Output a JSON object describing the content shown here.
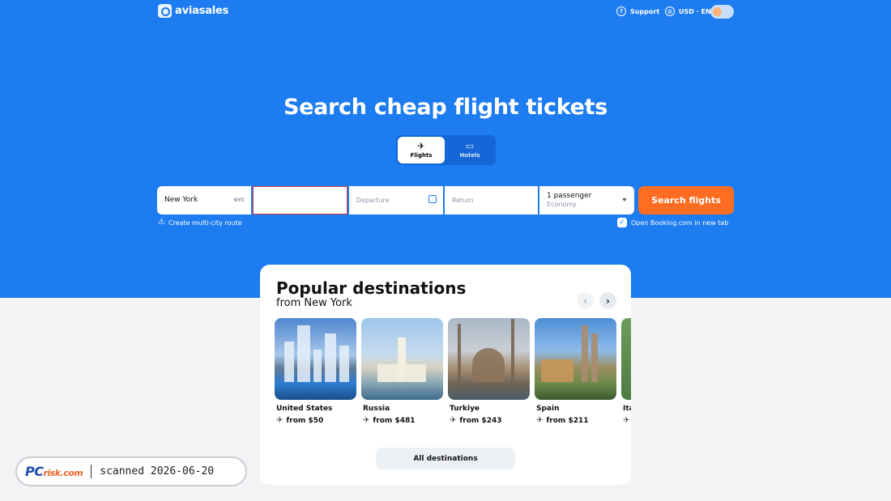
{
  "header": {
    "brand": "aviasales",
    "support_label": "Support",
    "locale_label": "USD · EN"
  },
  "hero": {
    "headline": "Search cheap flight tickets",
    "tabs": [
      {
        "label": "Flights",
        "icon": "plane-icon",
        "selected": true
      },
      {
        "label": "Hotels",
        "icon": "bed-icon",
        "selected": false
      }
    ]
  },
  "search": {
    "origin_value": "New York",
    "origin_code": "NYC",
    "destination_value": "",
    "departure_placeholder": "Departure",
    "return_placeholder": "Return",
    "passengers": "1 passenger",
    "cabin_class": "Economy",
    "submit_label": "Search flights",
    "multicity_label": "Create multi-city route",
    "booking_label": "Open Booking.com in new tab",
    "booking_checked": true
  },
  "popular": {
    "title": "Popular destinations",
    "subtitle": "from New York",
    "destinations": [
      {
        "name": "United States",
        "price": "from $50"
      },
      {
        "name": "Russia",
        "price": "from $481"
      },
      {
        "name": "Turkiye",
        "price": "from $243"
      },
      {
        "name": "Spain",
        "price": "from $211"
      },
      {
        "name": "Ita",
        "price": ""
      }
    ],
    "all_label": "All destinations"
  },
  "watermark": {
    "logo_main": "PC",
    "logo_rest": "risk.com",
    "scan_text": "scanned 2026-06-20"
  },
  "colors": {
    "hero_blue": "#1c7cf0",
    "accent_orange": "#ff6d22",
    "error_red": "#e23a3a"
  }
}
